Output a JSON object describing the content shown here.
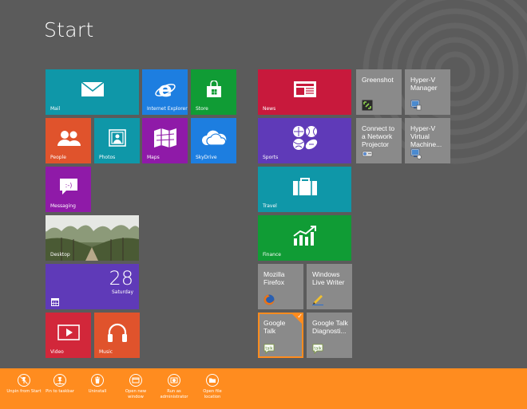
{
  "screen": {
    "title": "Start"
  },
  "colors": {
    "background": "#5b5b5b",
    "teal": "#0f97a8",
    "blue": "#1d7ee0",
    "green": "#109c35",
    "orange": "#e0532c",
    "purple": "#8f1aa8",
    "violet": "#5f3ab8",
    "news_red": "#c8193c",
    "red": "#d2273a",
    "grey_tile": "#8a8a8a",
    "appbar": "#ff8c1f"
  },
  "tiles": {
    "mail": {
      "label": "Mail",
      "icon": "mail-icon"
    },
    "ie": {
      "label": "Internet Explorer",
      "icon": "ie-icon"
    },
    "store": {
      "label": "Store",
      "icon": "store-icon"
    },
    "people": {
      "label": "People",
      "icon": "people-icon"
    },
    "photos": {
      "label": "Photos",
      "icon": "photos-icon"
    },
    "maps": {
      "label": "Maps",
      "icon": "maps-icon"
    },
    "skydrive": {
      "label": "SkyDrive",
      "icon": "cloud-icon"
    },
    "messaging": {
      "label": "Messaging",
      "icon": "messaging-icon"
    },
    "desktop": {
      "label": "Desktop"
    },
    "calendar": {
      "date": "28",
      "day": "Saturday",
      "icon": "calendar-icon"
    },
    "video": {
      "label": "Video",
      "icon": "play-icon"
    },
    "music": {
      "label": "Music",
      "icon": "headphones-icon"
    },
    "news": {
      "label": "News",
      "icon": "newspaper-icon"
    },
    "sports": {
      "label": "Sports",
      "icon": "sports-icon"
    },
    "travel": {
      "label": "Travel",
      "icon": "suitcase-icon"
    },
    "finance": {
      "label": "Finance",
      "icon": "chart-icon"
    },
    "greenshot": {
      "title": "Greenshot"
    },
    "hyperv_manager": {
      "title": "Hyper-V Manager"
    },
    "connect_projector": {
      "title": "Connect to a Network Projector"
    },
    "hyperv_vm": {
      "title": "Hyper-V Virtual Machine..."
    },
    "firefox": {
      "title": "Mozilla Firefox"
    },
    "live_writer": {
      "title": "Windows Live Writer"
    },
    "google_talk": {
      "title": "Google Talk",
      "selected": true
    },
    "google_talk_diag": {
      "title": "Google Talk Diagnosti..."
    }
  },
  "appbar": {
    "commands": [
      {
        "label": "Unpin from Start",
        "icon": "unpin-icon"
      },
      {
        "label": "Pin to taskbar",
        "icon": "pin-icon"
      },
      {
        "label": "Uninstall",
        "icon": "trash-icon"
      },
      {
        "label": "Open new window",
        "icon": "new-window-icon"
      },
      {
        "label": "Run as administrator",
        "icon": "shield-icon"
      },
      {
        "label": "Open file location",
        "icon": "folder-icon"
      }
    ]
  }
}
